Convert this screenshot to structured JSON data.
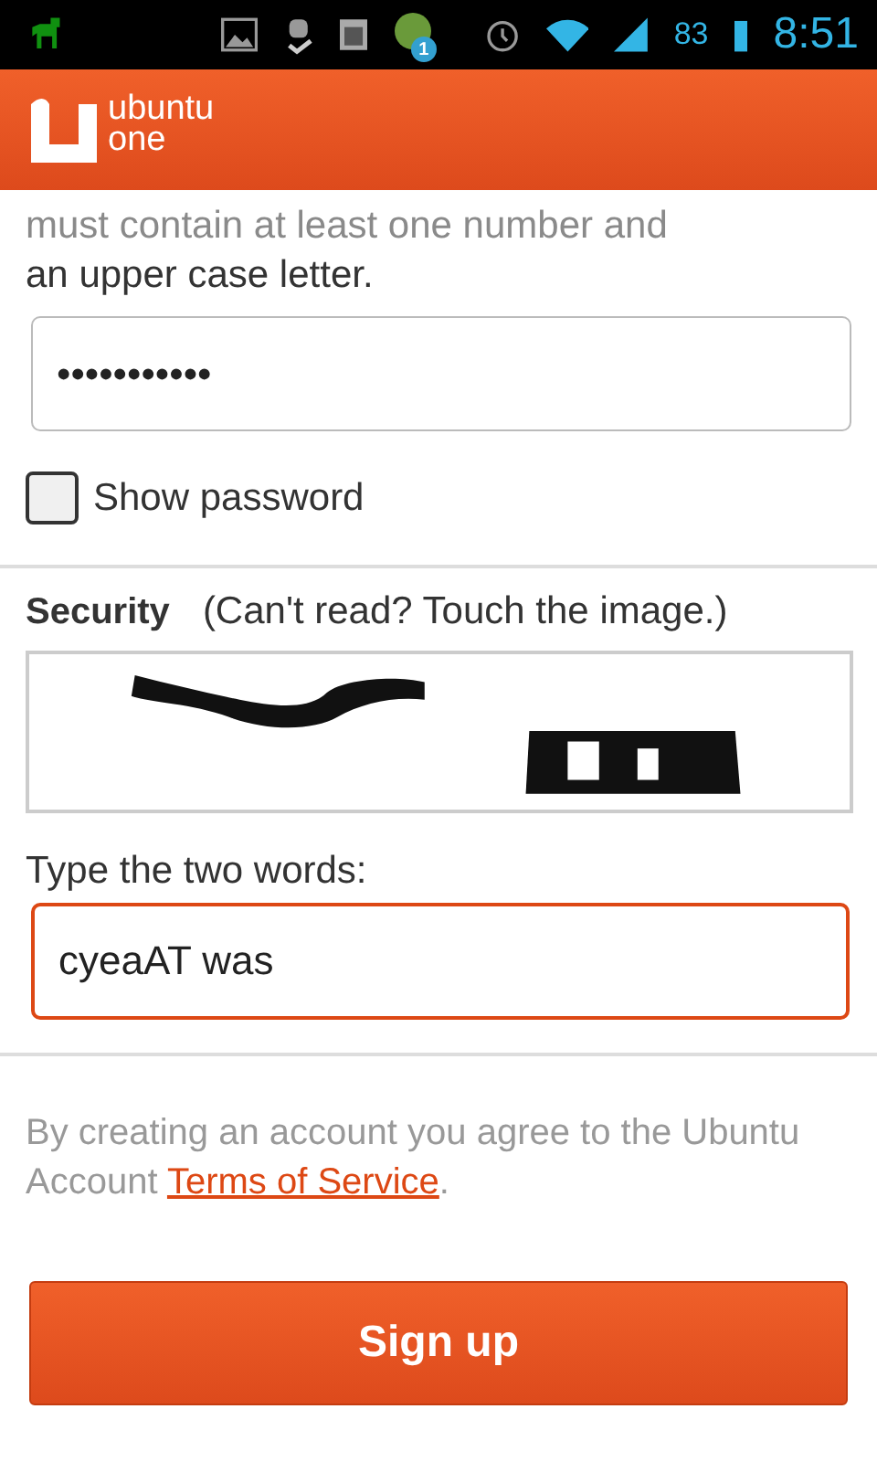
{
  "status_bar": {
    "battery": "83",
    "time": "8:51",
    "notification_badge": "1"
  },
  "header": {
    "logo_line_1": "ubuntu",
    "logo_line_2": "one"
  },
  "password_hint": {
    "line_1": "must contain at least one number and",
    "line_2": "an upper case letter."
  },
  "password_field": {
    "value": "•••••••••••"
  },
  "show_password": {
    "label": "Show password",
    "checked": false
  },
  "security": {
    "label": "Security",
    "hint": "(Can't read? Touch the image.)"
  },
  "captcha_answer": {
    "label": "Type the two words:",
    "value": "cyeaAT was",
    "focused": true
  },
  "terms": {
    "text": "By creating an account you agree to the Ubuntu Account",
    "link": "Terms of Service",
    "end": "."
  },
  "submit": {
    "label": "Sign up"
  }
}
